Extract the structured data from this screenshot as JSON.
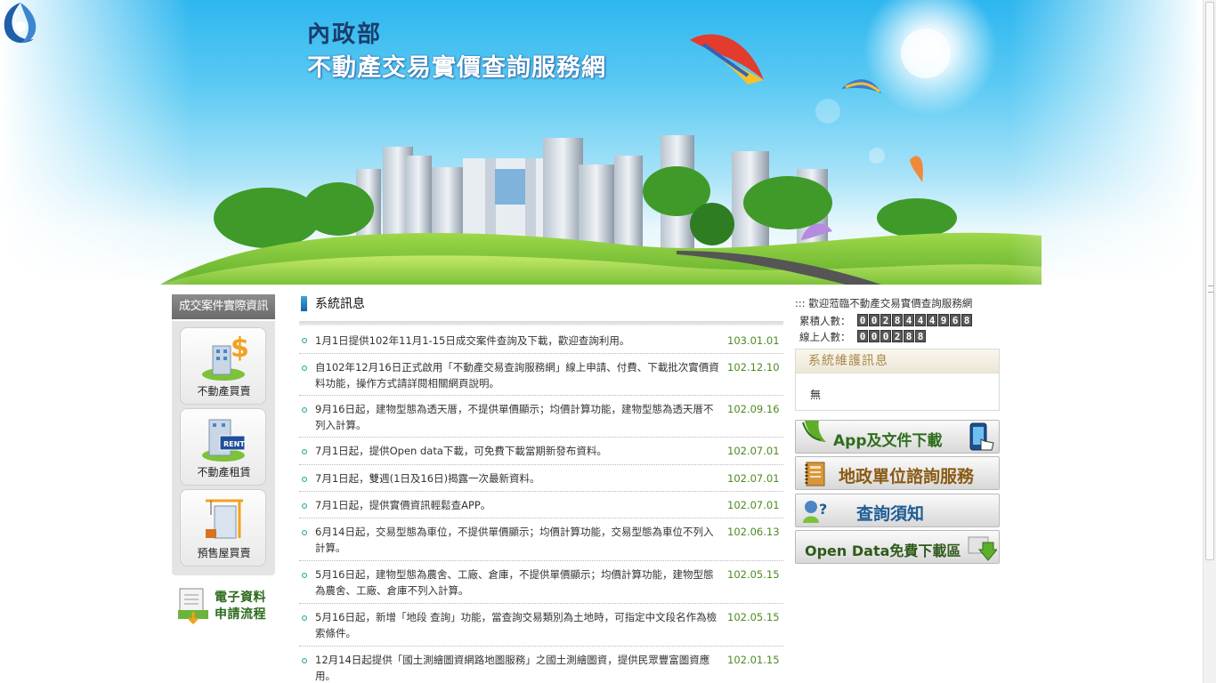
{
  "header": {
    "org_name": "內政部",
    "site_name": "不動產交易實價查詢服務網"
  },
  "sidebar": {
    "title": "成交案件實際資訊",
    "items": [
      {
        "label": "不動產買賣",
        "icon": "dollar-building-icon"
      },
      {
        "label": "不動產租賃",
        "icon": "for-rent-building-icon"
      },
      {
        "label": "預售屋買賣",
        "icon": "crane-building-icon"
      }
    ],
    "edoc": {
      "line1": "電子資料",
      "line2": "申請流程",
      "icon": "document-download-icon"
    }
  },
  "news": {
    "title": "系統訊息",
    "items": [
      {
        "text": "1月1日提供102年11月1-15日成交案件查詢及下載，歡迎查詢利用。",
        "date": "103.01.01"
      },
      {
        "text": "自102年12月16日正式啟用「不動產交易查詢服務網」線上申請、付費、下載批次實價資料功能，操作方式請詳閱相關網頁說明。",
        "date": "102.12.10"
      },
      {
        "text": "9月16日起，建物型態為透天厝，不提供單價顯示；均價計算功能，建物型態為透天厝不列入計算。",
        "date": "102.09.16"
      },
      {
        "text": "7月1日起，提供Open data下載，可免費下載當期新發布資料。",
        "date": "102.07.01"
      },
      {
        "text": "7月1日起，雙週(1日及16日)揭露一次最新資料。",
        "date": "102.07.01"
      },
      {
        "text": "7月1日起，提供實價資訊輕鬆查APP。",
        "date": "102.07.01"
      },
      {
        "text": "6月14日起，交易型態為車位，不提供單價顯示；均價計算功能，交易型態為車位不列入計算。",
        "date": "102.06.13"
      },
      {
        "text": "5月16日起，建物型態為農舍、工廠、倉庫，不提供單價顯示；均價計算功能，建物型態為農舍、工廠、倉庫不列入計算。",
        "date": "102.05.15"
      },
      {
        "text": "5月16日起，新增「地段 查詢」功能，當查詢交易類別為土地時，可指定中文段名作為檢索條件。",
        "date": "102.05.15"
      },
      {
        "text": "12月14日起提供「國土測繪圖資網路地圖服務」之國土測繪圖資，提供民眾豐富圖資應用。",
        "date": "102.01.15"
      }
    ]
  },
  "right": {
    "welcome": "::: 歡迎蒞臨不動產交易實價查詢服務網",
    "total_label": "累積人數：",
    "total_digits": [
      "0",
      "0",
      "2",
      "8",
      "4",
      "4",
      "4",
      "9",
      "6",
      "8"
    ],
    "online_label": "線上人數：",
    "online_digits": [
      "0",
      "0",
      "0",
      "2",
      "8",
      "8"
    ],
    "maintenance_title": "系統維護訊息",
    "maintenance_body": "無",
    "buttons": [
      {
        "label": "App及文件下載",
        "icon": "phone-tap-icon",
        "color": "#2f6e1c"
      },
      {
        "label": "地政單位諮詢服務",
        "icon": "notebook-icon",
        "color": "#8a5a14"
      },
      {
        "label": "查詢須知",
        "icon": "person-question-icon",
        "color": "#1f5c95"
      },
      {
        "label": "Open Data免費下載區",
        "icon": "download-arrow-icon",
        "color": "#2f5a1a"
      }
    ]
  }
}
